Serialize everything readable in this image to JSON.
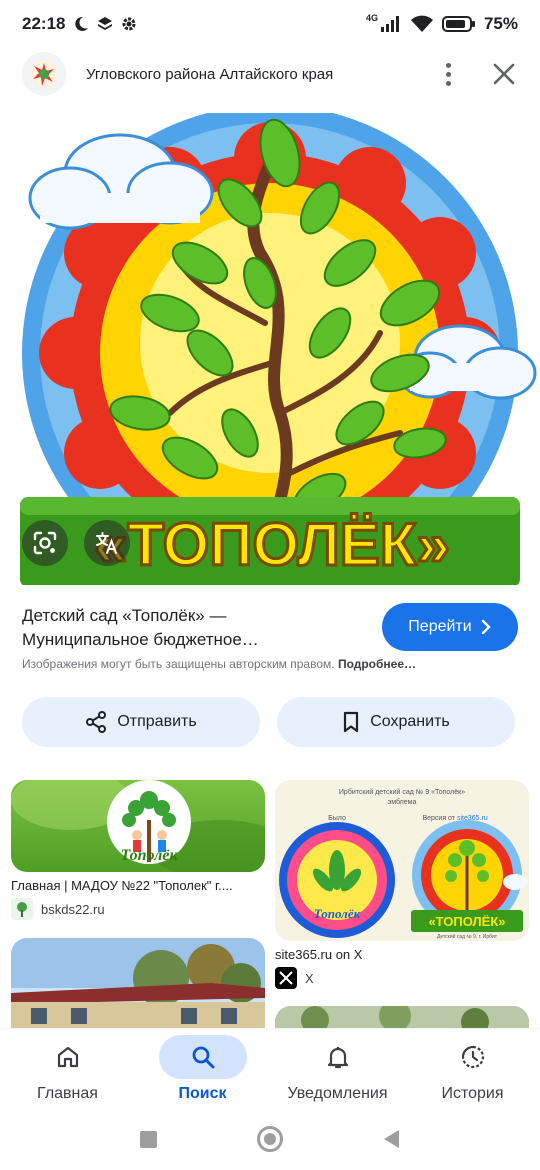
{
  "status_bar": {
    "time": "22:18",
    "network": "4G",
    "battery": "75%"
  },
  "header": {
    "title": "Угловского района Алтайского края"
  },
  "hero": {
    "logo_text": "«ТОПОЛЁК»"
  },
  "result": {
    "title_line1": "Детский сад «Тополёк» —",
    "title_line2": "Муниципальное бюджетное…",
    "go_label": "Перейти",
    "copyright": "Изображения могут быть защищены авторским правом.",
    "more_link": "Подробнее…"
  },
  "actions": {
    "share_label": "Отправить",
    "save_label": "Сохранить"
  },
  "grid": {
    "card1": {
      "caption": "Главная | МАДОУ №22 \"Тополек\" г....",
      "source": "bskds22.ru",
      "logo_text": "Тополёк"
    },
    "card2": {
      "caption": "site365.ru on X",
      "source": "X",
      "header_line1": "Ирбитский детский сад № 9 «Тополёк»",
      "header_line2": "эмблема",
      "was_label": "Было",
      "version_label": "Версия от",
      "version_site": "site365.ru",
      "old_logo_text": "Тополёк",
      "new_logo_text": "«ТОПОЛЁК»",
      "footer_text": "Детский сад № 9, г. Ирбит"
    }
  },
  "bottom_nav": {
    "items": [
      {
        "label": "Главная",
        "icon": "home-icon"
      },
      {
        "label": "Поиск",
        "icon": "search-icon"
      },
      {
        "label": "Уведомления",
        "icon": "bell-icon"
      },
      {
        "label": "История",
        "icon": "history-icon"
      }
    ],
    "active": "Поиск"
  },
  "colors": {
    "accent": "#1a73e8",
    "pill_bg": "#e8f0fe",
    "active_nav": "#d3e3fd"
  }
}
